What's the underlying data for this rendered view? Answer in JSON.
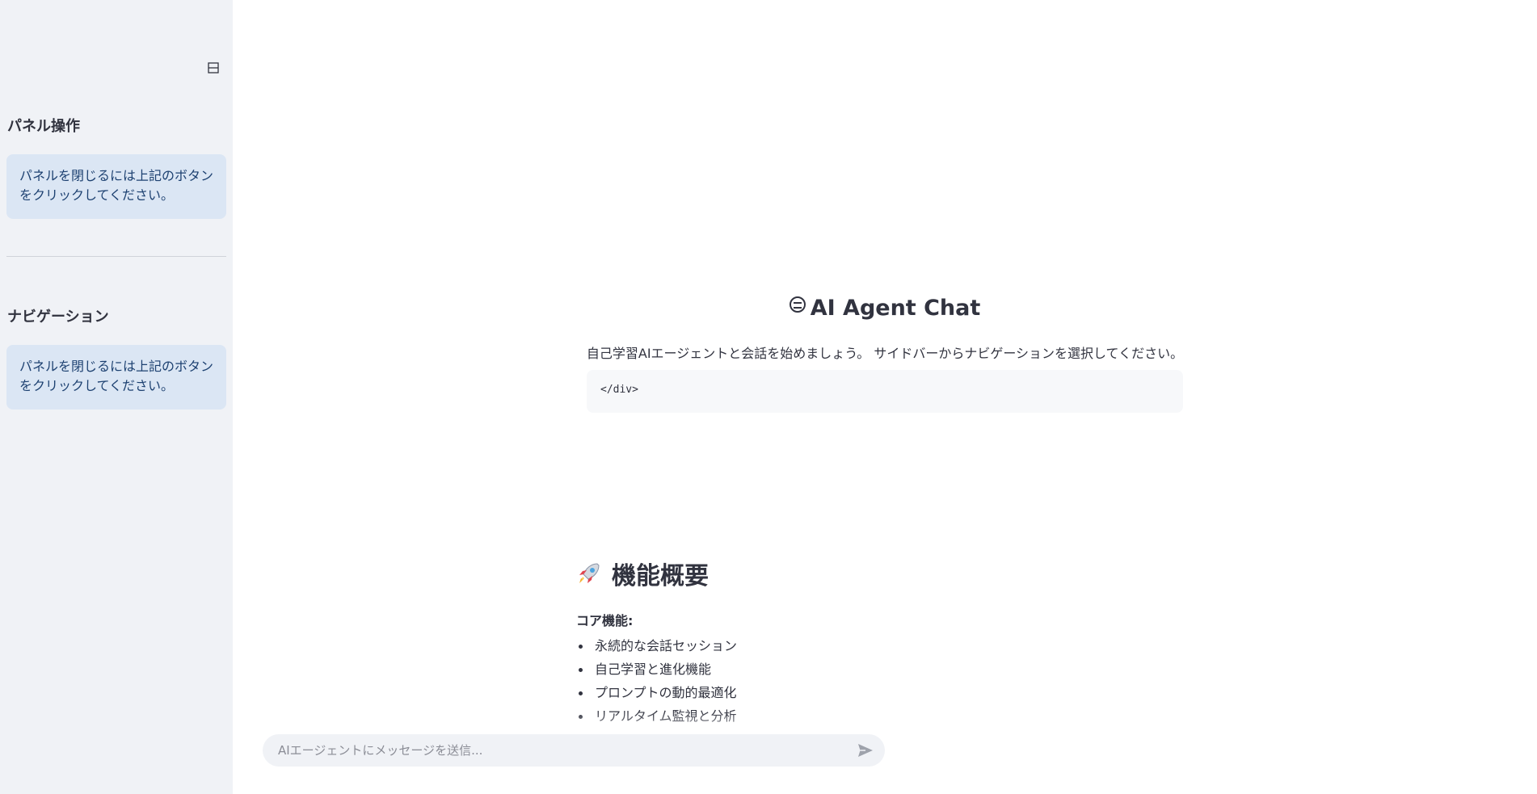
{
  "sidebar": {
    "collapse_icon": "sidebar-collapse-icon",
    "sections": [
      {
        "heading": "パネル操作",
        "info": "パネルを閉じるには上記のボタンをクリックしてください。"
      },
      {
        "heading": "ナビゲーション",
        "info": "パネルを閉じるには上記のボタンをクリックしてください。"
      }
    ]
  },
  "main": {
    "hero": {
      "title": "AI Agent Chat",
      "title_icon": "sunglasses-face-icon",
      "subtitle": "自己学習AIエージェントと会話を始めましょう。 サイドバーからナビゲーションを選択してください。",
      "code": "</div>"
    },
    "features": {
      "title": "機能概要",
      "title_icon": "rocket-icon",
      "core_label": "コア機能:",
      "items": [
        "永続的な会話セッション",
        "自己学習と進化機能",
        "プロンプトの動的最適化",
        "リアルタイム監視と分析"
      ]
    }
  },
  "chat": {
    "placeholder": "AIエージェントにメッセージを送信...",
    "value": "",
    "send_icon": "send-icon"
  },
  "colors": {
    "sidebar_bg": "#f0f2f6",
    "info_bg": "#dbe6f4",
    "info_text": "#1d4171",
    "text": "#31333f"
  }
}
